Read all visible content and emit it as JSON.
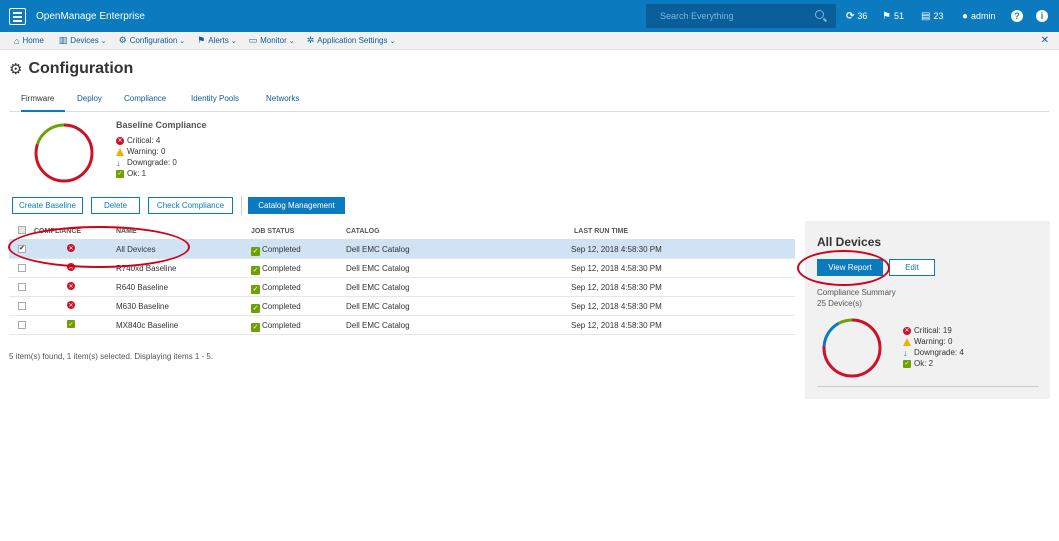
{
  "app": {
    "title": "OpenManage Enterprise"
  },
  "search": {
    "placeholder": "Search Everything"
  },
  "topbar": {
    "jobs_count": "36",
    "alerts_count": "51",
    "reports_count": "23",
    "user": "admin",
    "help_icon": "?",
    "info_icon": "i"
  },
  "nav": {
    "items": [
      {
        "label": "Home",
        "icon": "home-icon"
      },
      {
        "label": "Devices",
        "icon": "devices-icon"
      },
      {
        "label": "Configuration",
        "icon": "configuration-icon"
      },
      {
        "label": "Alerts",
        "icon": "flag-icon"
      },
      {
        "label": "Monitor",
        "icon": "monitor-icon"
      },
      {
        "label": "Application Settings",
        "icon": "gear-icon"
      }
    ]
  },
  "page": {
    "title": "Configuration"
  },
  "tabs": [
    {
      "label": "Firmware",
      "active": true
    },
    {
      "label": "Deploy"
    },
    {
      "label": "Compliance"
    },
    {
      "label": "Identity Pools"
    },
    {
      "label": "Networks"
    }
  ],
  "baseline_compliance": {
    "title": "Baseline Compliance",
    "critical": "Critical: 4",
    "warning": "Warning: 0",
    "downgrade": "Downgrade: 0",
    "ok": "Ok: 1",
    "chart_fraction": {
      "critical": 0.8,
      "ok": 0.2
    }
  },
  "toolbar": {
    "create": "Create Baseline",
    "delete": "Delete",
    "check": "Check Compliance",
    "catalog": "Catalog Management"
  },
  "grid": {
    "headers": {
      "compliance": "Compliance",
      "name": "Name",
      "job_status": "Job Status",
      "catalog": "Catalog",
      "last_run": "Last Run Time"
    },
    "rows": [
      {
        "status": "critical",
        "name": "All Devices",
        "job": "Completed",
        "catalog": "Dell EMC Catalog",
        "last_run": "Sep 12, 2018 4:58:30 PM",
        "selected": true
      },
      {
        "status": "critical",
        "name": "R740xd Baseline",
        "job": "Completed",
        "catalog": "Dell EMC Catalog",
        "last_run": "Sep 12, 2018 4:58:30 PM"
      },
      {
        "status": "critical",
        "name": "R640 Baseline",
        "job": "Completed",
        "catalog": "Dell EMC Catalog",
        "last_run": "Sep 12, 2018 4:58:30 PM"
      },
      {
        "status": "critical",
        "name": "M630 Baseline",
        "job": "Completed",
        "catalog": "Dell EMC Catalog",
        "last_run": "Sep 12, 2018 4:58:30 PM"
      },
      {
        "status": "ok",
        "name": "MX840c Baseline",
        "job": "Completed",
        "catalog": "Dell EMC Catalog",
        "last_run": "Sep 12, 2018 4:58:30 PM"
      }
    ],
    "footer": "5 item(s) found, 1 item(s) selected. Displaying items 1 - 5."
  },
  "panel": {
    "title": "All Devices",
    "view_report": "View Report",
    "edit": "Edit",
    "summary_title": "Compliance Summary",
    "device_count": "25 Device(s)",
    "critical": "Critical: 19",
    "warning": "Warning: 0",
    "downgrade": "Downgrade: 4",
    "ok": "Ok: 2",
    "chart_fraction": {
      "critical": 0.76,
      "downgrade": 0.16,
      "ok": 0.08
    }
  },
  "colors": {
    "brand": "#0b7abf",
    "critical": "#ce1126",
    "warning": "#f2af00",
    "ok": "#6ea204",
    "downgrade": "#0b7abf"
  }
}
